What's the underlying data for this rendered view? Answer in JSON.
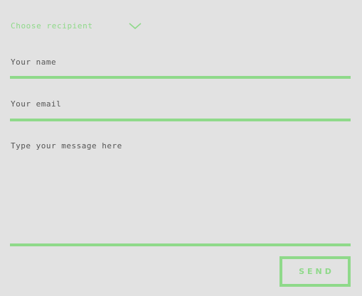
{
  "form": {
    "recipient": {
      "placeholder": "Choose recipient",
      "icon": "chevron-down-icon"
    },
    "name": {
      "placeholder": "Your name",
      "value": ""
    },
    "email": {
      "placeholder": "Your email",
      "value": ""
    },
    "message": {
      "placeholder": "Type your message here",
      "value": ""
    },
    "send_label": "SEND"
  },
  "colors": {
    "background": "#e2e2e2",
    "accent": "#8fd98a",
    "placeholder_text": "#555555"
  }
}
